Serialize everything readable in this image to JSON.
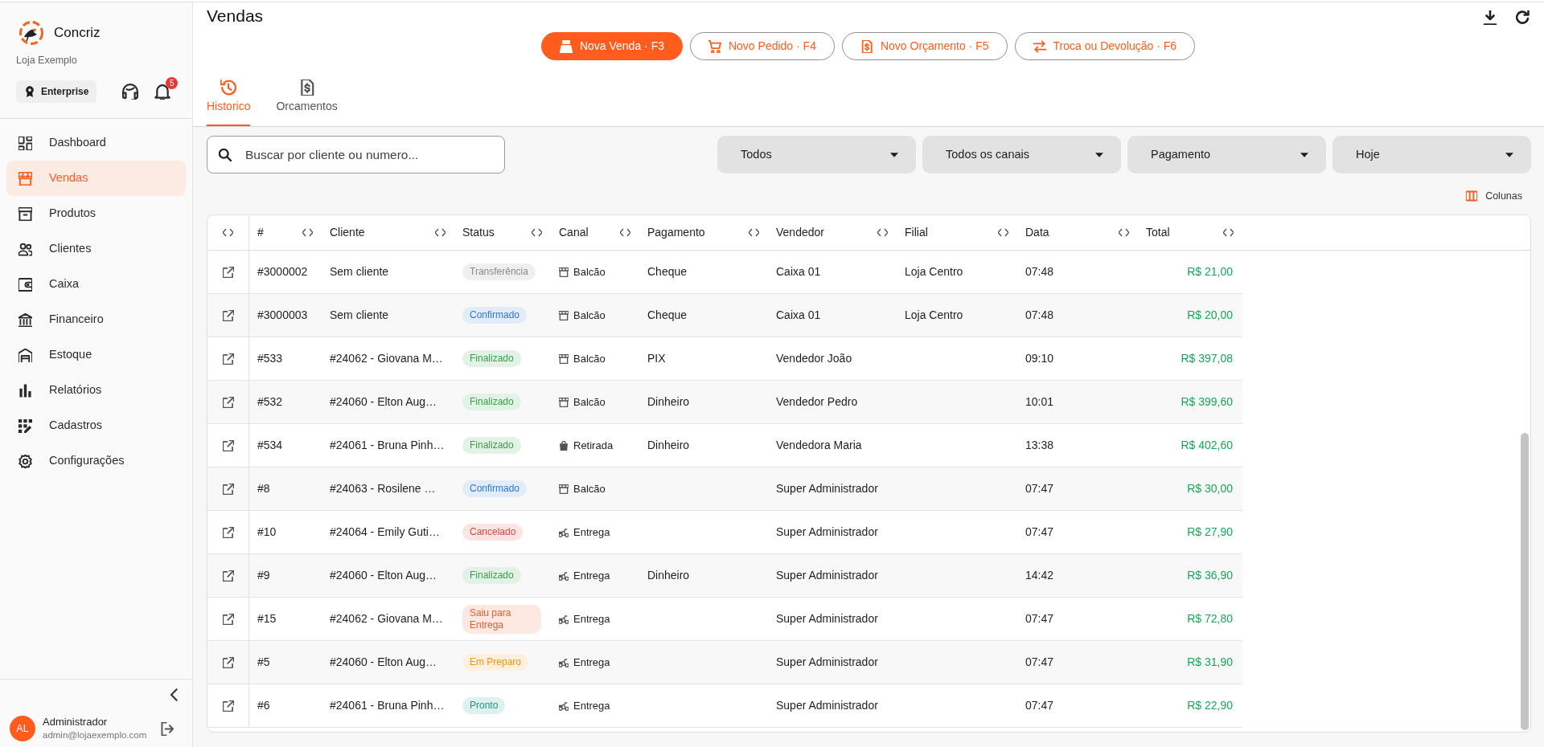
{
  "sidebar": {
    "brand": "Concriz",
    "store": "Loja Exemplo",
    "plan": "Enterprise",
    "notification_count": "5",
    "items": [
      {
        "label": "Dashboard",
        "selected": false
      },
      {
        "label": "Vendas",
        "selected": true
      },
      {
        "label": "Produtos",
        "selected": false
      },
      {
        "label": "Clientes",
        "selected": false
      },
      {
        "label": "Caixa",
        "selected": false
      },
      {
        "label": "Financeiro",
        "selected": false
      },
      {
        "label": "Estoque",
        "selected": false
      },
      {
        "label": "Relatórios",
        "selected": false
      },
      {
        "label": "Cadastros",
        "selected": false
      },
      {
        "label": "Configurações",
        "selected": false
      }
    ],
    "user": {
      "initials": "AL",
      "name": "Administrador",
      "email": "admin@lojaexemplo.com"
    }
  },
  "header": {
    "title": "Vendas",
    "actions": [
      {
        "label": "Nova Venda · F3",
        "kind": "filled"
      },
      {
        "label": "Novo Pedido · F4",
        "kind": "outlined"
      },
      {
        "label": "Novo Orçamento · F5",
        "kind": "outlined"
      },
      {
        "label": "Troca ou Devolução · F6",
        "kind": "outlined"
      }
    ]
  },
  "tabs": [
    {
      "label": "Historico",
      "selected": true
    },
    {
      "label": "Orcamentos",
      "selected": false
    }
  ],
  "filters": {
    "search": {
      "placeholder": "Buscar por cliente ou numero..."
    },
    "dropdowns": [
      {
        "value": "Todos"
      },
      {
        "value": "Todos os canais"
      },
      {
        "value": "Pagamento"
      },
      {
        "value": "Hoje"
      }
    ],
    "columns_button": "Colunas"
  },
  "table": {
    "columns": [
      "#",
      "Cliente",
      "Status",
      "Canal",
      "Pagamento",
      "Vendedor",
      "Filial",
      "Data",
      "Total"
    ],
    "rows": [
      {
        "number": "#3000002",
        "client": "Sem cliente",
        "status": {
          "label": "Transferência",
          "color": "#8a8a8a"
        },
        "channel": {
          "label": "Balcão",
          "kind": "counter"
        },
        "payment": "Cheque",
        "seller": "Caixa 01",
        "branch": "Loja Centro",
        "time": "07:48",
        "total": "R$ 21,00"
      },
      {
        "number": "#3000003",
        "client": "Sem cliente",
        "status": {
          "label": "Confirmado",
          "color": "#2f77e0"
        },
        "channel": {
          "label": "Balcão",
          "kind": "counter"
        },
        "payment": "Cheque",
        "seller": "Caixa 01",
        "branch": "Loja Centro",
        "time": "07:48",
        "total": "R$ 20,00"
      },
      {
        "number": "#533",
        "client": "#24062 - Giovana M…",
        "status": {
          "label": "Finalizado",
          "color": "#3a9f4b"
        },
        "channel": {
          "label": "Balcão",
          "kind": "counter"
        },
        "payment": "PIX",
        "seller": "Vendedor João",
        "time": "09:10",
        "total": "R$ 397,08"
      },
      {
        "number": "#532",
        "client": "#24060 - Elton Aug…",
        "status": {
          "label": "Finalizado",
          "color": "#3a9f4b"
        },
        "channel": {
          "label": "Balcão",
          "kind": "counter"
        },
        "payment": "Dinheiro",
        "seller": "Vendedor Pedro",
        "time": "10:01",
        "total": "R$ 399,60"
      },
      {
        "number": "#534",
        "client": "#24061 - Bruna Pinh…",
        "status": {
          "label": "Finalizado",
          "color": "#3a9f4b"
        },
        "channel": {
          "label": "Retirada",
          "kind": "pickup"
        },
        "payment": "Dinheiro",
        "seller": "Vendedora Maria",
        "time": "13:38",
        "total": "R$ 402,60"
      },
      {
        "number": "#8",
        "client": "#24063 - Rosilene …",
        "status": {
          "label": "Confirmado",
          "color": "#2f77e0"
        },
        "channel": {
          "label": "Balcão",
          "kind": "counter"
        },
        "seller": "Super Administrador",
        "time": "07:47",
        "total": "R$ 30,00"
      },
      {
        "number": "#10",
        "client": "#24064 - Emily Guti…",
        "status": {
          "label": "Cancelado",
          "color": "#e0453f"
        },
        "channel": {
          "label": "Entrega",
          "kind": "delivery"
        },
        "seller": "Super Administrador",
        "time": "07:47",
        "total": "R$ 27,90"
      },
      {
        "number": "#9",
        "client": "#24060 - Elton Aug…",
        "status": {
          "label": "Finalizado",
          "color": "#3a9f4b"
        },
        "channel": {
          "label": "Entrega",
          "kind": "delivery"
        },
        "payment": "Dinheiro",
        "seller": "Super Administrador",
        "time": "14:42",
        "total": "R$ 36,90"
      },
      {
        "number": "#15",
        "client": "#24062 - Giovana M…",
        "status": {
          "label": "Saiu para Entrega",
          "color": "#f05a2e"
        },
        "channel": {
          "label": "Entrega",
          "kind": "delivery"
        },
        "seller": "Super Administrador",
        "time": "07:47",
        "total": "R$ 72,80"
      },
      {
        "number": "#5",
        "client": "#24060 - Elton Aug…",
        "status": {
          "label": "Em Preparo",
          "color": "#f0921c"
        },
        "channel": {
          "label": "Entrega",
          "kind": "delivery"
        },
        "seller": "Super Administrador",
        "time": "07:47",
        "total": "R$ 31,90"
      },
      {
        "number": "#6",
        "client": "#24061 - Bruna Pinh…",
        "status": {
          "label": "Pronto",
          "color": "#189a86"
        },
        "channel": {
          "label": "Entrega",
          "kind": "delivery"
        },
        "seller": "Super Administrador",
        "time": "07:47",
        "total": "R$ 22,90"
      }
    ]
  }
}
